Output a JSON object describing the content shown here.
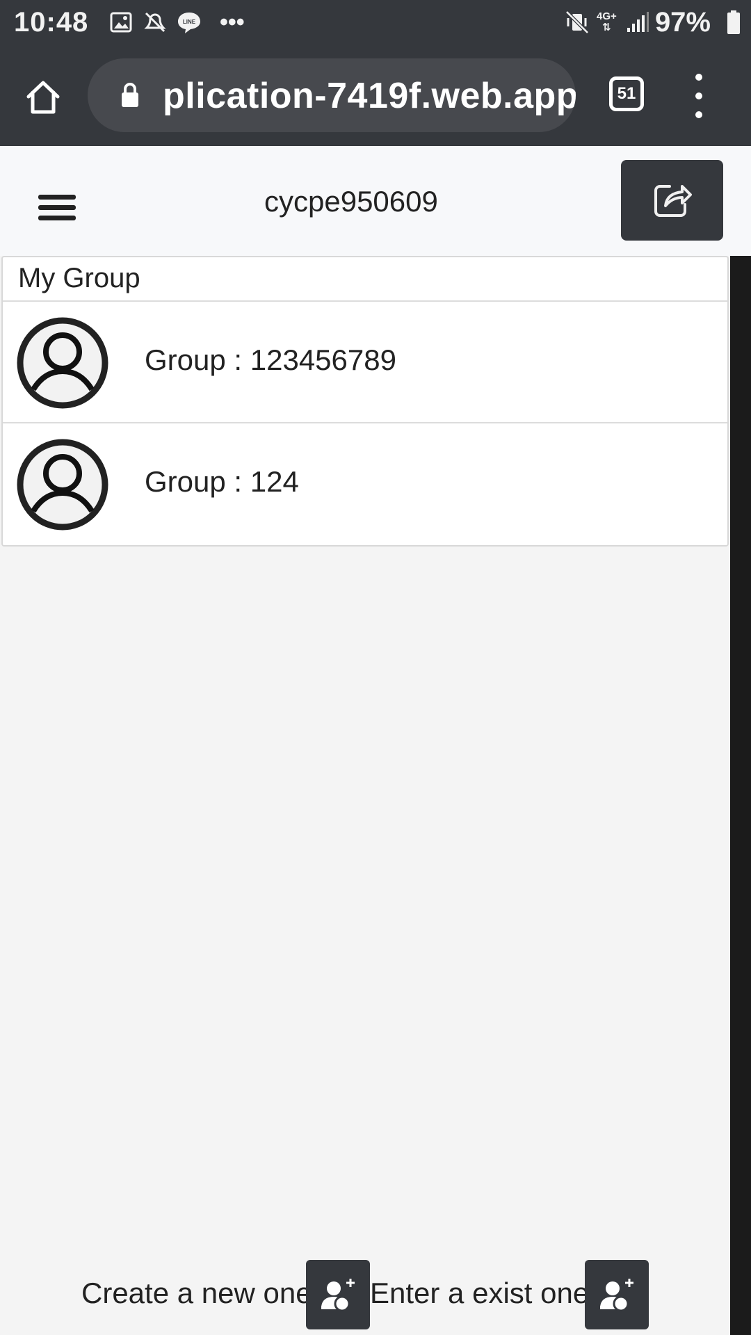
{
  "status_bar": {
    "time": "10:48",
    "battery": "97%",
    "icons": [
      "image-icon",
      "notification-off-icon",
      "line-app-icon",
      "more-notifications-icon",
      "mute-vibrate-icon",
      "4g-icon",
      "signal-icon",
      "battery-icon"
    ],
    "dots": "•••",
    "network": "4G+"
  },
  "browser": {
    "url": "plication-7419f.web.app",
    "tab_count": "51"
  },
  "header": {
    "title": "cycpe950609"
  },
  "group_list": {
    "title": "My Group",
    "items": [
      {
        "label": "Group : 123456789"
      },
      {
        "label": "Group : 124"
      }
    ]
  },
  "actions": {
    "create_label": "Create a new one",
    "enter_label": "Enter a exist one"
  },
  "colors": {
    "dark_bar": "#35383d",
    "page_bg": "#f4f4f4"
  }
}
